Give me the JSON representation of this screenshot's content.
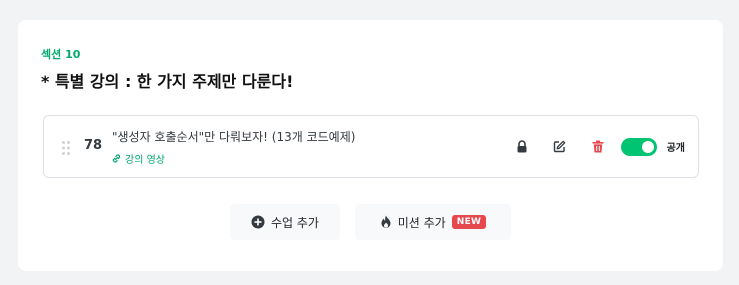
{
  "section": {
    "label": "섹션 10",
    "title": "* 특별 강의 : 한 가지 주제만 다룬다!"
  },
  "lesson": {
    "number": "78",
    "title": "\"생성자 호출순서\"만 다뤄보자! (13개 코드예제)",
    "type_label": "강의 영상",
    "visibility_label": "공개",
    "public_enabled": true
  },
  "icons": {
    "drag": "drag-handle-icon",
    "link": "link-icon",
    "lock": "lock-icon",
    "edit": "edit-icon",
    "delete": "trash-icon",
    "add": "plus-circle-icon",
    "mission": "fire-icon"
  },
  "buttons": {
    "add_lesson": "수업 추가",
    "add_mission": "미션 추가",
    "new_badge": "NEW"
  },
  "colors": {
    "accent": "#00c471",
    "accent_text": "#00a86b",
    "danger": "#e5484d"
  }
}
